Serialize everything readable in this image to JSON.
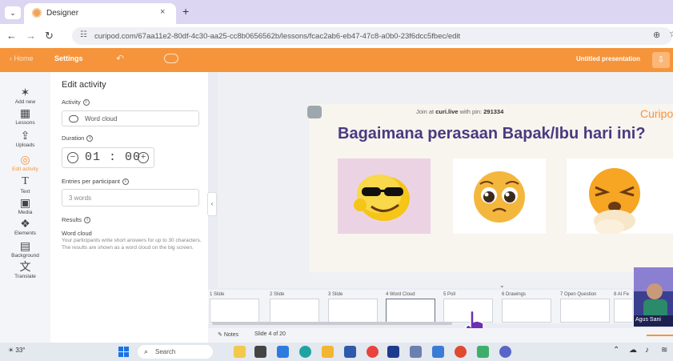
{
  "browser": {
    "tab_title": "Designer",
    "tab_close": "×",
    "new_tab": "+",
    "url": "curipod.com/67aa11e2-80df-4c30-aa25-cc8b0656562b/lessons/fcac2ab6-eb47-47c8-a0b0-23f6dcc5fbec/edit"
  },
  "app_toolbar": {
    "home_label": "‹ Home",
    "settings_label": "Settings",
    "presentation_title": "Untitled presentation"
  },
  "rail": {
    "items": [
      {
        "label": "Add new",
        "icon": "magic-wand-icon"
      },
      {
        "label": "Lessons",
        "icon": "grid-icon"
      },
      {
        "label": "Uploads",
        "icon": "cloud-upload-icon"
      },
      {
        "label": "Edit activity",
        "icon": "edit-activity-icon"
      },
      {
        "label": "Text",
        "icon": "text-icon"
      },
      {
        "label": "Media",
        "icon": "media-icon"
      },
      {
        "label": "Elements",
        "icon": "elements-icon"
      },
      {
        "label": "Background",
        "icon": "background-icon"
      },
      {
        "label": "Translate",
        "icon": "translate-icon"
      }
    ],
    "active_index": 3
  },
  "panel": {
    "title": "Edit activity",
    "activity_label": "Activity",
    "activity_value": "Word cloud",
    "duration_label": "Duration",
    "duration_value": "01 : 00",
    "entries_label": "Entries per participant",
    "entries_value": "3 words",
    "results_label": "Results",
    "results_type": "Word cloud",
    "results_desc": "Your participants write short answers for up to 30 characters. The results are shown as a word cloud on the big screen."
  },
  "slide": {
    "join_prefix": "Join at ",
    "join_site": "curi.live",
    "join_middle": " with pin: ",
    "join_pin": "291334",
    "brand": "Curipod",
    "question": "Bagaimana perasaan Bapak/Ibu hari ini?"
  },
  "thumbnails": [
    {
      "label": "1 Slide"
    },
    {
      "label": "2 Slide"
    },
    {
      "label": "3 Slide"
    },
    {
      "label": "4 Word Cloud"
    },
    {
      "label": "5 Poll"
    },
    {
      "label": "6 Drawings"
    },
    {
      "label": "7 Open Question"
    },
    {
      "label": "8 AI Fe"
    }
  ],
  "current_thumbnail": 3,
  "notes": {
    "notes_label": "Notes",
    "slide_count": "Slide 4 of 20"
  },
  "webcam": {
    "name": "Agus Sani"
  },
  "taskbar": {
    "weather": "33°",
    "search_label": "Search"
  },
  "colors": {
    "accent": "#f6943b",
    "question": "#4a3a80",
    "tab_strip": "#ddd6f2"
  }
}
